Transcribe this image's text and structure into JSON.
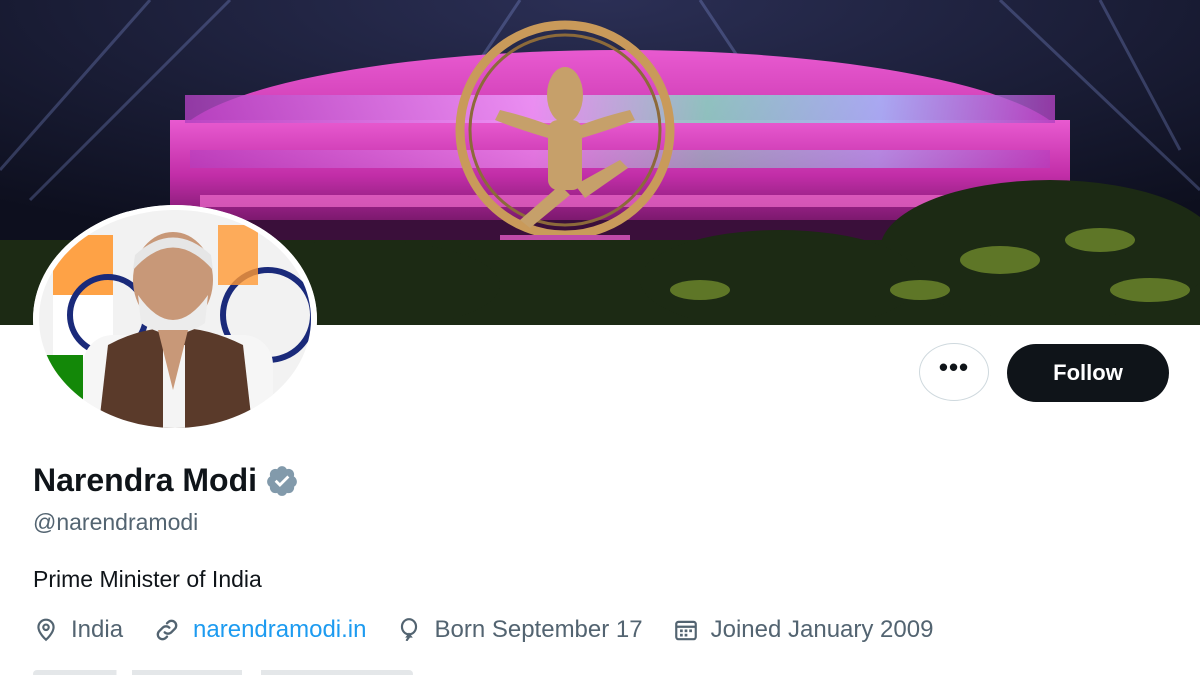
{
  "banner": {
    "image_description_icon": "banner-image"
  },
  "avatar": {
    "icon": "profile-photo"
  },
  "actions": {
    "more_label": "•••",
    "follow_label": "Follow"
  },
  "profile": {
    "display_name": "Narendra Modi",
    "handle": "@narendramodi",
    "bio": "Prime Minister of India",
    "location": "India",
    "website": "narendramodi.in",
    "birthday": "Born September 17",
    "joined": "Joined January 2009"
  },
  "colors": {
    "text_primary": "#0f1419",
    "text_secondary": "#536471",
    "link": "#1d9bf0",
    "verified_badge": "#829aab",
    "follow_bg": "#0f1419"
  }
}
